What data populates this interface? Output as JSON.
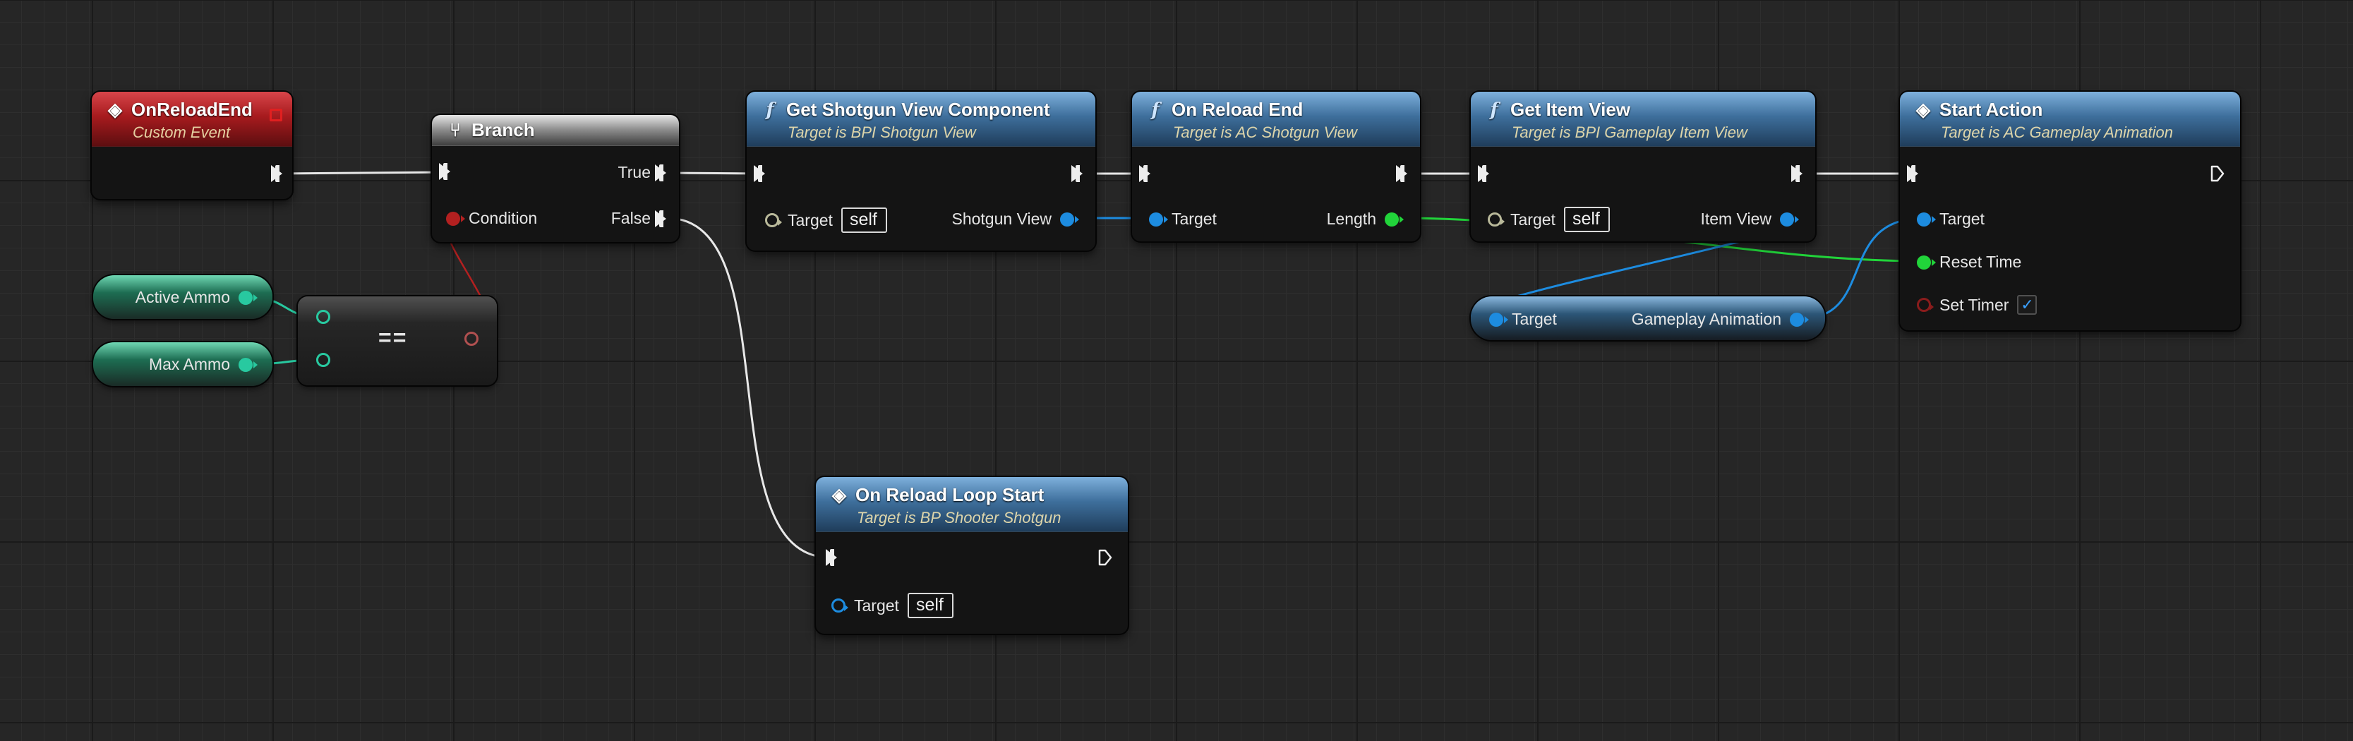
{
  "nodes": {
    "on_reload_end_event": {
      "title": "OnReloadEnd",
      "subtitle": "Custom Event"
    },
    "branch": {
      "title": "Branch",
      "condition_label": "Condition",
      "true_label": "True",
      "false_label": "False"
    },
    "get_shotgun_view_component": {
      "title": "Get Shotgun View Component",
      "subtitle": "Target is BPI Shotgun View",
      "target_label": "Target",
      "target_value": "self",
      "output_label": "Shotgun View"
    },
    "on_reload_end_call": {
      "title": "On Reload End",
      "subtitle": "Target is AC Shotgun View",
      "target_label": "Target",
      "output_label": "Length"
    },
    "get_item_view": {
      "title": "Get Item View",
      "subtitle": "Target is BPI Gameplay Item View",
      "target_label": "Target",
      "target_value": "self",
      "output_label": "Item View"
    },
    "start_action": {
      "title": "Start Action",
      "subtitle": "Target is AC Gameplay Animation",
      "target_label": "Target",
      "reset_time_label": "Reset Time",
      "set_timer_label": "Set Timer",
      "set_timer_checked": true
    },
    "on_reload_loop_start": {
      "title": "On Reload Loop Start",
      "subtitle": "Target is BP Shooter Shotgun",
      "target_label": "Target",
      "target_value": "self"
    },
    "gameplay_animation_getter": {
      "target_label": "Target",
      "output_label": "Gameplay Animation"
    },
    "active_ammo_var": {
      "label": "Active Ammo"
    },
    "max_ammo_var": {
      "label": "Max Ammo"
    },
    "equals_op": {
      "symbol": "=="
    }
  },
  "colors": {
    "exec": "#ededed",
    "object_pin": "#1d8ce0",
    "float_pin": "#21d43a",
    "bool_pin": "#b32020",
    "int_pin": "#28c9a0",
    "function_header": "#3e6f9c",
    "event_header": "#a71b1e"
  }
}
